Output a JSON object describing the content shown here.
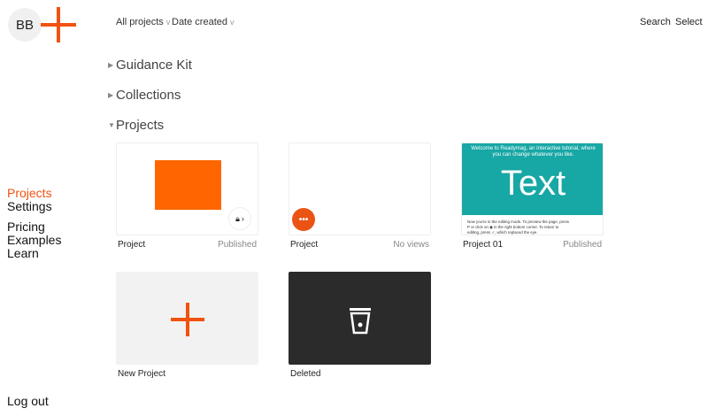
{
  "user": {
    "initials": "BB"
  },
  "filters": [
    {
      "label": "All projects"
    },
    {
      "label": "Date created"
    }
  ],
  "toolbar": {
    "search": "Search",
    "select": "Select"
  },
  "sections": [
    {
      "label": "Guidance Kit",
      "expanded": false
    },
    {
      "label": "Collections",
      "expanded": false
    },
    {
      "label": "Projects",
      "expanded": true
    }
  ],
  "nav": {
    "primary": [
      "Projects",
      "Settings"
    ],
    "secondary": [
      "Pricing",
      "Examples",
      "Learn"
    ],
    "logout": "Log out"
  },
  "projects": [
    {
      "title": "Project",
      "status": "Published"
    },
    {
      "title": "Project",
      "status": "No views"
    },
    {
      "title": "Project 01",
      "status": "Published",
      "thumb_heading": "Text",
      "thumb_intro": "Welcome to Readymag, an interactive tutorial, where you can change whatever you like.",
      "thumb_body": "Now you're in the editing mode. To preview the page, press P or click on ◉ in the right bottom corner. To return to editing, press ✓, which replaced the eye."
    },
    {
      "title": "New Project"
    },
    {
      "title": "Deleted"
    }
  ],
  "colors": {
    "accent": "#f2520f",
    "teal": "#17a7a5",
    "dark": "#2b2b2b"
  }
}
